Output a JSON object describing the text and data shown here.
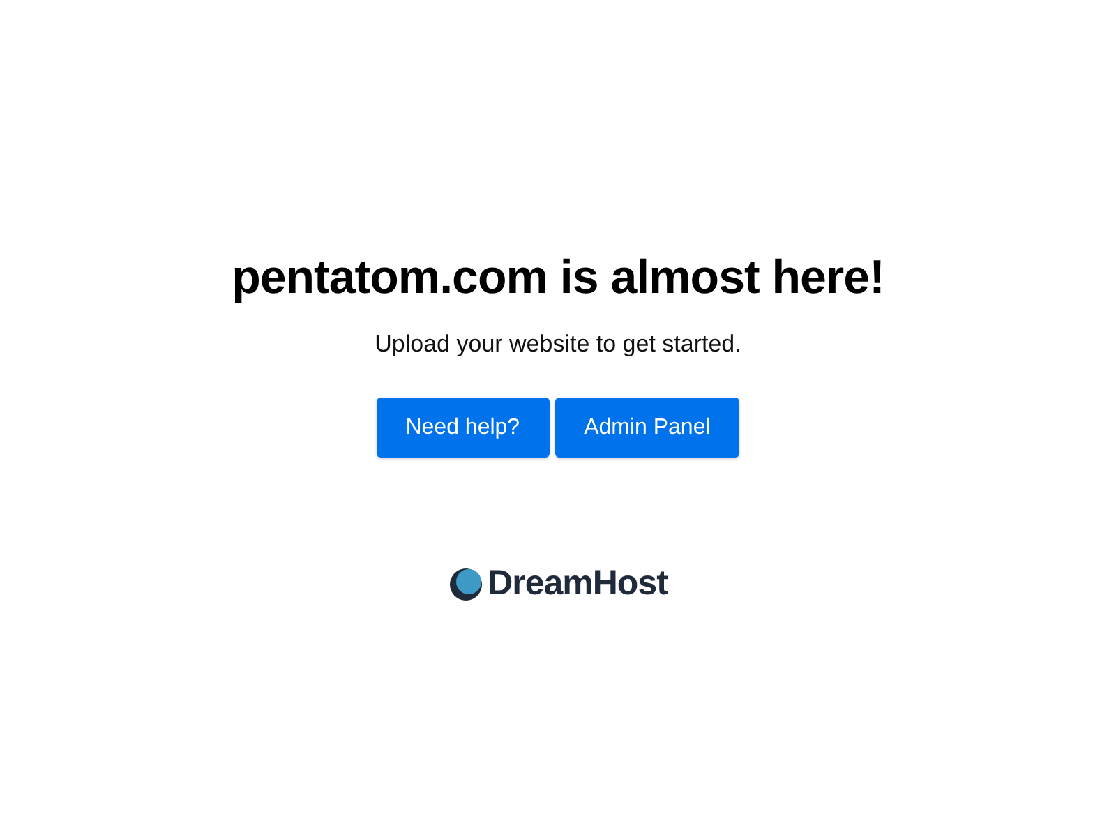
{
  "heading": "pentatom.com is almost here!",
  "subtitle": "Upload your website to get started.",
  "buttons": [
    "Need help?",
    "Admin Panel"
  ],
  "logo": {
    "text": "DreamHost"
  }
}
